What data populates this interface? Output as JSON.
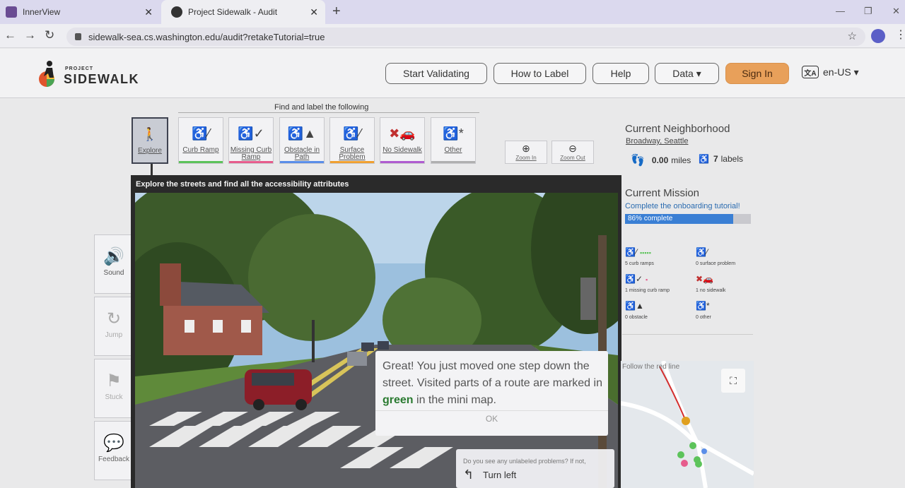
{
  "browser": {
    "tabs": [
      {
        "title": "InnerView",
        "active": false
      },
      {
        "title": "Project Sidewalk - Audit",
        "active": true
      }
    ],
    "url": "sidewalk-sea.cs.washington.edu/audit?retakeTutorial=true"
  },
  "header": {
    "logo_top": "PROJECT",
    "logo_main": "SIDEWALK",
    "nav": {
      "validate": "Start Validating",
      "howto": "How to Label",
      "help": "Help",
      "data": "Data ▾",
      "signin": "Sign In",
      "language": "en-US ▾"
    }
  },
  "toolbar": {
    "prompt": "Find and label the following",
    "explore": "Explore",
    "curb_ramp": "Curb Ramp",
    "missing_curb_ramp": "Missing Curb Ramp",
    "obstacle": "Obstacle in Path",
    "surface": "Surface Problem",
    "no_sidewalk": "No Sidewalk",
    "other": "Other",
    "zoom_in": "Zoom In",
    "zoom_out": "Zoom Out",
    "colors": {
      "curb_ramp": "#5cc35a",
      "missing_curb_ramp": "#e65c8c",
      "obstacle": "#5a8ee8",
      "surface": "#f0a030",
      "no_sidewalk": "#b05cd0",
      "other": "#b0b0b0"
    }
  },
  "side": {
    "sound": "Sound",
    "jump": "Jump",
    "stuck": "Stuck",
    "feedback": "Feedback"
  },
  "pano": {
    "title": "Explore the streets and find all the accessibility attributes",
    "message": {
      "before": "Great! You just moved one step down the street. Visited parts of a route are marked in ",
      "highlight": "green",
      "after": " in the mini map.",
      "ok": "OK"
    },
    "turn_prompt": "Do you see any unlabeled problems? If not,",
    "turn_label": "Turn left"
  },
  "status": {
    "neighborhood_title": "Current Neighborhood",
    "neighborhood_name": "Broadway, Seattle",
    "distance_value": "0.00",
    "distance_unit": "miles",
    "labels_value": "7",
    "labels_unit": "labels",
    "mission_title": "Current Mission",
    "mission_desc": "Complete the onboarding tutorial!",
    "progress_text": "86% complete",
    "progress_fraction": 0.86,
    "counts": {
      "curb_ramps": "5 curb ramps",
      "surface_problem": "0 surface problem",
      "missing_curb_ramp": "1 missing curb ramp",
      "no_sidewalk": "1 no sidewalk",
      "obstacle": "0 obstacle",
      "other": "0 other"
    },
    "minimap_hint": "Follow the red line"
  }
}
